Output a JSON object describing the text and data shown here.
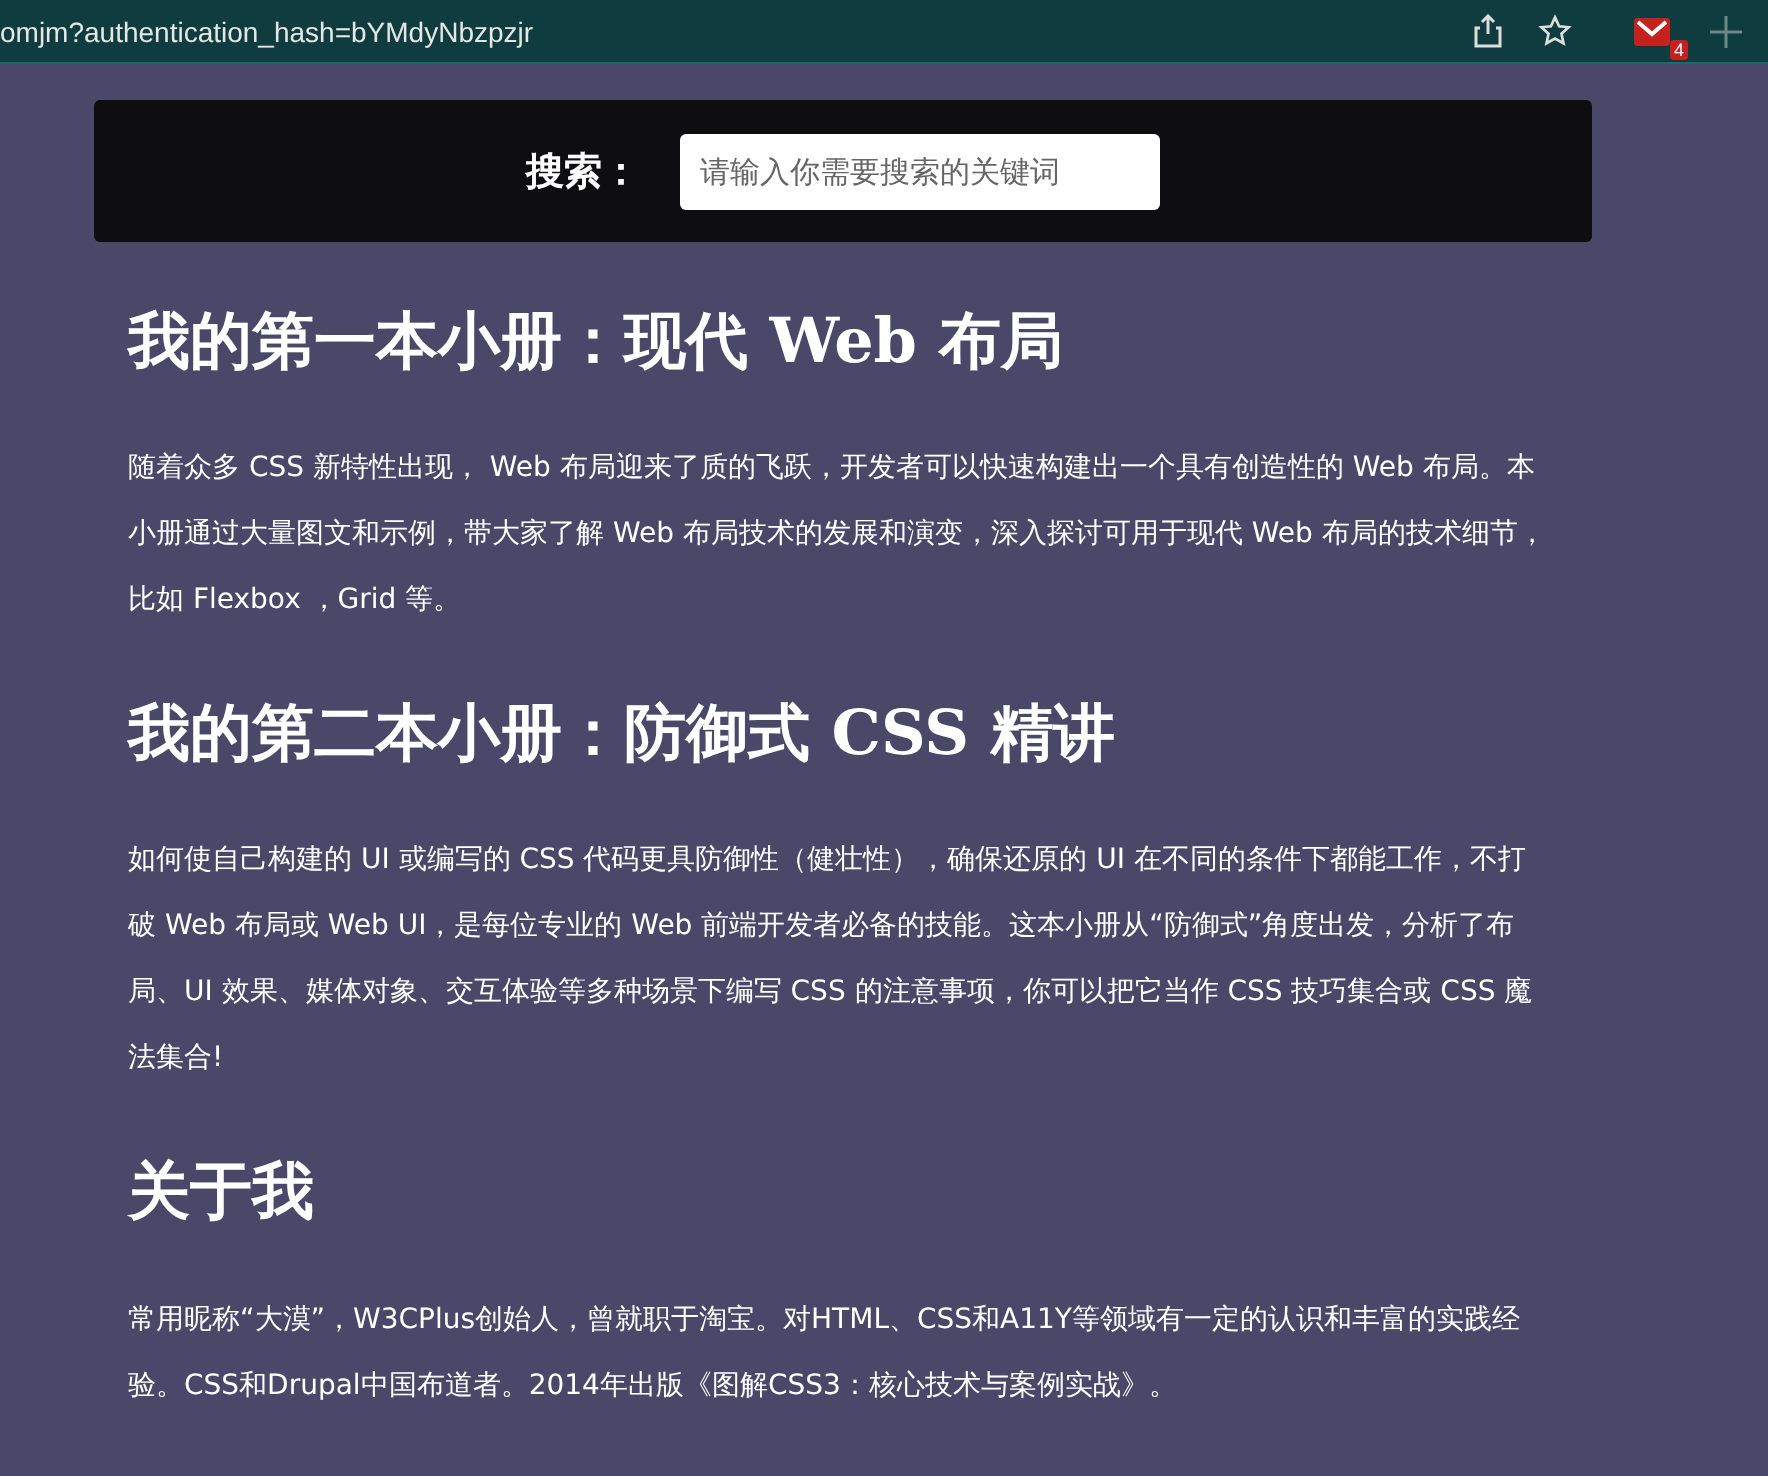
{
  "browser": {
    "url": "omjm?authentication_hash=bYMdyNbzpzjr",
    "extension_badge": "4"
  },
  "search": {
    "label": "搜索：",
    "placeholder": "请输入你需要搜索的关键词"
  },
  "sections": [
    {
      "heading": "我的第一本小册：现代 Web 布局",
      "text": "随着众多 CSS 新特性出现， Web 布局迎来了质的飞跃，开发者可以快速构建出一个具有创造性的 Web 布局。本小册通过大量图文和示例，带大家了解 Web 布局技术的发展和演变，深入探讨可用于现代 Web 布局的技术细节，比如 Flexbox ，Grid 等。"
    },
    {
      "heading": "我的第二本小册：防御式 CSS 精讲",
      "text": "如何使自己构建的 UI 或编写的 CSS 代码更具防御性（健壮性），确保还原的 UI 在不同的条件下都能工作，不打破 Web 布局或 Web UI，是每位专业的 Web 前端开发者必备的技能。这本小册从“防御式”角度出发，分析了布局、UI 效果、媒体对象、交互体验等多种场景下编写 CSS 的注意事项，你可以把它当作 CSS 技巧集合或 CSS 魔法集合!"
    },
    {
      "heading": "关于我",
      "text": "常用昵称“大漠”，W3CPlus创始人，曾就职于淘宝。对HTML、CSS和A11Y等领域有一定的认识和丰富的实践经验。CSS和Drupal中国布道者。2014年出版《图解CSS3：核心技术与案例实战》。"
    }
  ]
}
